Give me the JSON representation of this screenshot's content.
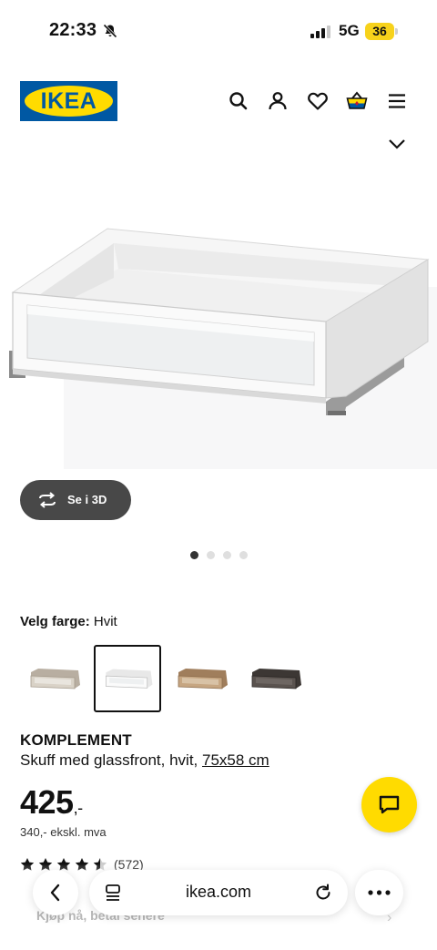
{
  "status_bar": {
    "time": "22:33",
    "network": "5G",
    "battery": "36"
  },
  "header": {
    "logo_text": "IKEA"
  },
  "gallery": {
    "view_3d_label": "Se i 3D",
    "dot_count": 4,
    "active_dot": 0
  },
  "color_picker": {
    "label": "Velg farge:",
    "value": "Hvit"
  },
  "product": {
    "name": "KOMPLEMENT",
    "description": "Skuff med glassfront, hvit, ",
    "size": "75x58 cm",
    "price": "425",
    "price_suffix": ",-",
    "price_ex_vat": "340,- ekskl. mva",
    "rating_count": "(572)",
    "rating": 4.5
  },
  "financing": {
    "text": "Kjøp nå, betal senere"
  },
  "browser": {
    "url": "ikea.com"
  },
  "colors": {
    "brand_blue": "#0058a3",
    "brand_yellow": "#ffdb00",
    "dark_button": "#484848"
  }
}
